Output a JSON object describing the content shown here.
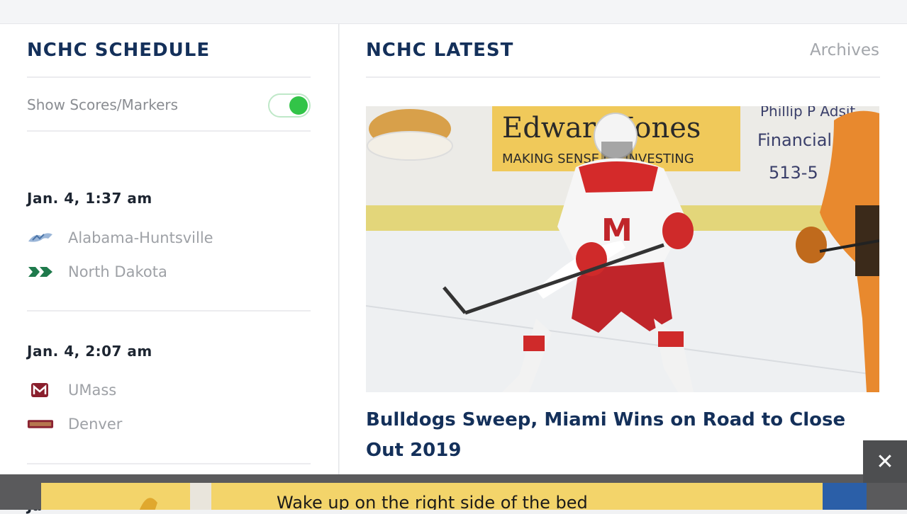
{
  "schedule": {
    "title": "NCHC SCHEDULE",
    "toggle_label": "Show Scores/Markers",
    "toggle_on": true,
    "games": [
      {
        "time": "Jan. 4, 1:37 am",
        "teams": [
          {
            "name": "Alabama-Huntsville",
            "icon": "alabama-huntsville-logo-icon"
          },
          {
            "name": "North Dakota",
            "icon": "north-dakota-logo-icon"
          }
        ]
      },
      {
        "time": "Jan. 4, 2:07 am",
        "teams": [
          {
            "name": "UMass",
            "icon": "umass-logo-icon"
          },
          {
            "name": "Denver",
            "icon": "denver-logo-icon"
          }
        ]
      }
    ],
    "next_peek": "Ja"
  },
  "latest": {
    "title": "NCHC LATEST",
    "archives_label": "Archives",
    "headline": "Bulldogs Sweep, Miami Wins on Road to Close Out 2019",
    "photo_text": {
      "banner_line1": "Edward Jones",
      "banner_line2": "MAKING SENSE OF INVESTING",
      "side_line1": "Phillip P Adsit",
      "side_line2": "Financial Advisor",
      "side_line3": "513-5"
    }
  },
  "ad": {
    "text": "Wake up on the right side of the bed",
    "close_label": "✕"
  },
  "colors": {
    "navy": "#14305a",
    "toggle_green": "#32c448",
    "ad_yellow": "#f3d46a"
  }
}
